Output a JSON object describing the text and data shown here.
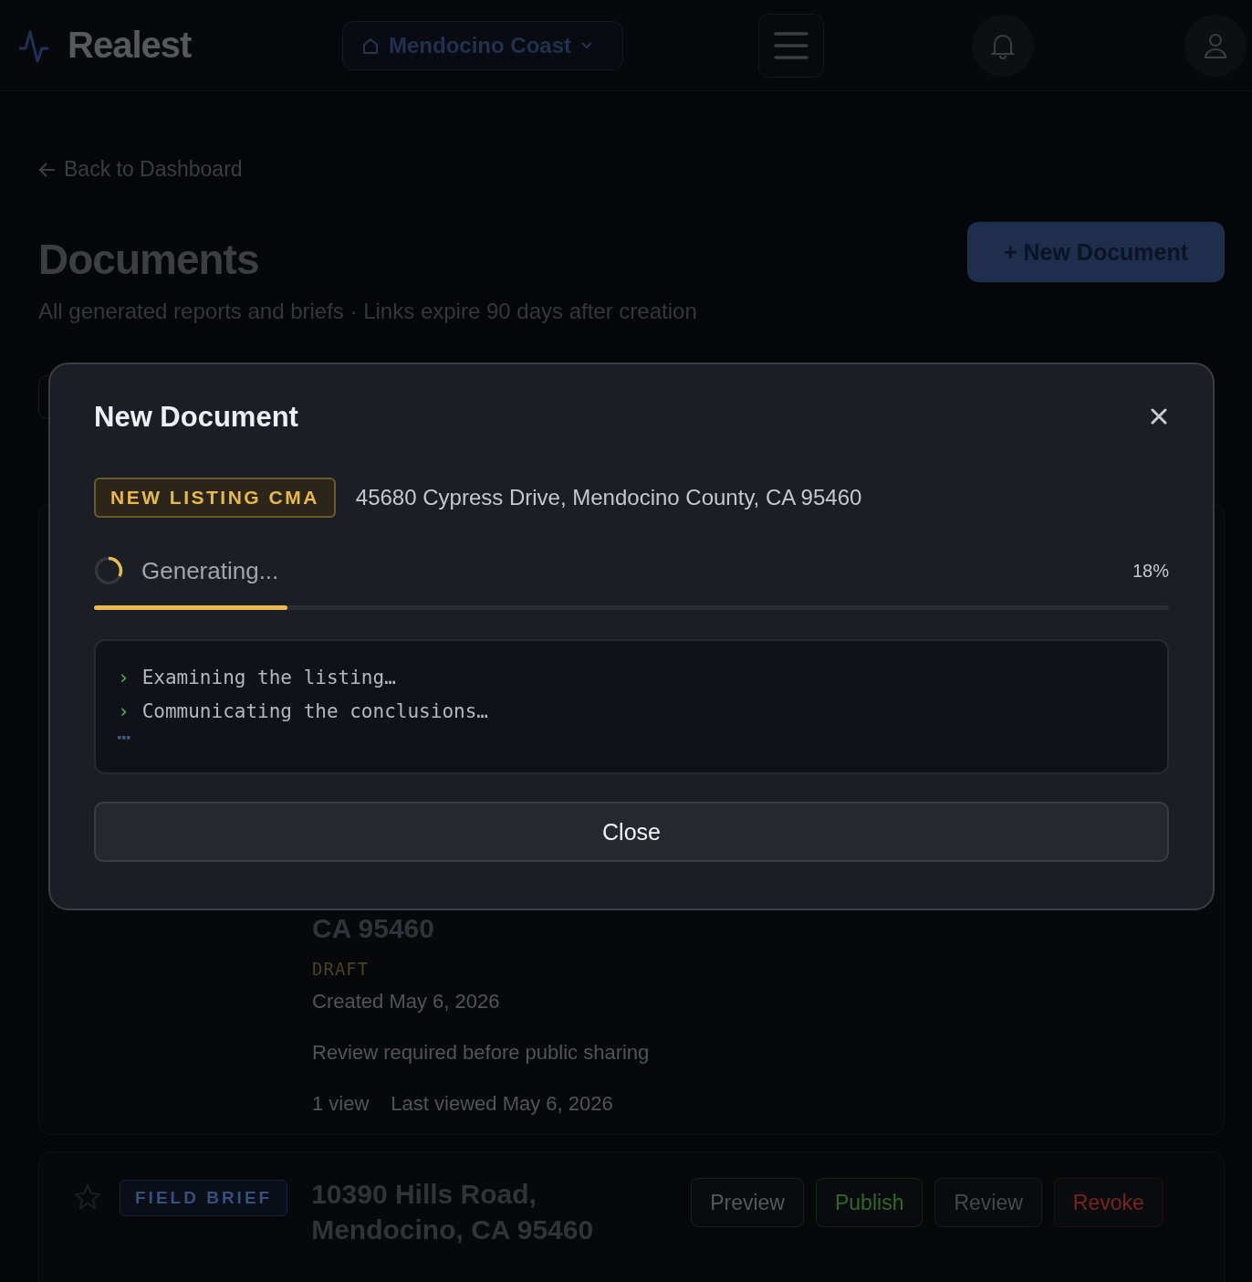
{
  "header": {
    "logo": "Realest",
    "region": "Mendocino Coast"
  },
  "page": {
    "back_link": "Back to Dashboard",
    "title": "Documents",
    "new_button": "+ New Document",
    "subtitle": "All generated reports and briefs · Links expire 90 days after creation"
  },
  "documents": [
    {
      "kind": "partial",
      "address": "CA 95460",
      "status": "DRAFT",
      "created": "Created May 6, 2026",
      "note": "Review required before public sharing",
      "views": "1 view",
      "last_viewed": "Last viewed May 6, 2026"
    },
    {
      "kind": "full",
      "starred": false,
      "type": "FIELD BRIEF",
      "address": "10390 Hills Road, Mendocino, CA 95460",
      "actions": [
        {
          "label": "Preview",
          "color": "#55585e"
        },
        {
          "label": "Publish",
          "color": "#2f6a26"
        },
        {
          "label": "Review",
          "color": "#45484e"
        },
        {
          "label": "Revoke",
          "color": "#7a2420"
        }
      ]
    }
  ],
  "modal": {
    "title": "New Document",
    "badge": "NEW LISTING CMA",
    "address": "45680 Cypress Drive, Mendocino County, CA 95460",
    "status": "Generating...",
    "percent": "18%",
    "level": 0.18,
    "log": [
      {
        "prompt": "›",
        "text": "Examining the listing…"
      },
      {
        "prompt": "›",
        "text": "Communicating the conclusions…"
      }
    ],
    "typing": true,
    "close_button": "Close"
  }
}
